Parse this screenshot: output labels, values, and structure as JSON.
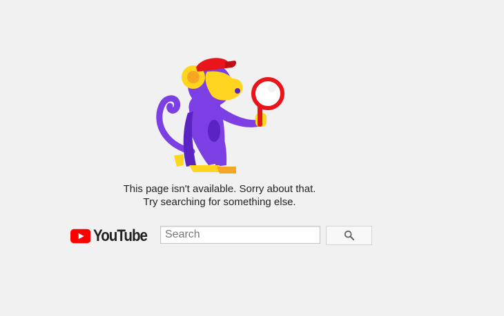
{
  "illustration": {
    "name": "monkey-with-magnifier",
    "colors": {
      "body": "#7b3fe4",
      "body_shadow": "#5a23c2",
      "face": "#ffd51f",
      "cap": "#e8161b",
      "magnifier": "#e8161b"
    }
  },
  "message": {
    "line1": "This page isn't available. Sorry about that.",
    "line2": "Try searching for something else."
  },
  "logo": {
    "wordmark": "YouTube",
    "icon": "youtube-play-icon",
    "color": "#ff0000"
  },
  "search": {
    "value": "",
    "placeholder": "Search",
    "button_icon": "search-icon"
  }
}
